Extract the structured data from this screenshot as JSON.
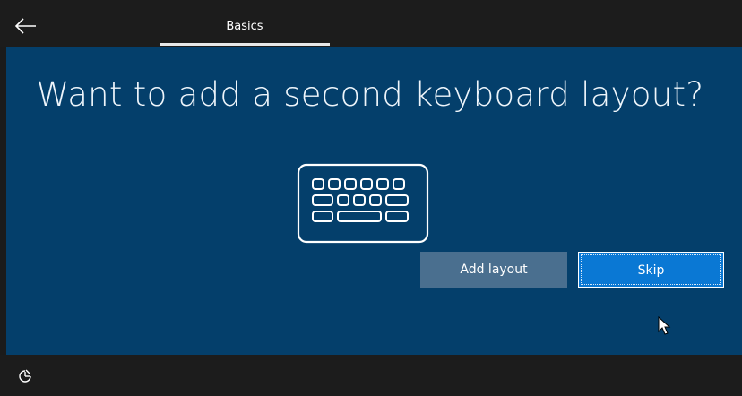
{
  "header": {
    "back_icon": "back-arrow-icon",
    "tab_label": "Basics"
  },
  "main": {
    "title": "Want to add a second keyboard layout?",
    "illustration_icon": "keyboard-icon",
    "background_color": "#043f6b"
  },
  "buttons": {
    "add_layout_label": "Add layout",
    "skip_label": "Skip"
  },
  "footer": {
    "accessibility_icon": "ease-of-access-icon"
  },
  "colors": {
    "accent": "#0a78d4",
    "secondary_button": "#4a6f8f",
    "chrome": "#1c1c1c"
  }
}
